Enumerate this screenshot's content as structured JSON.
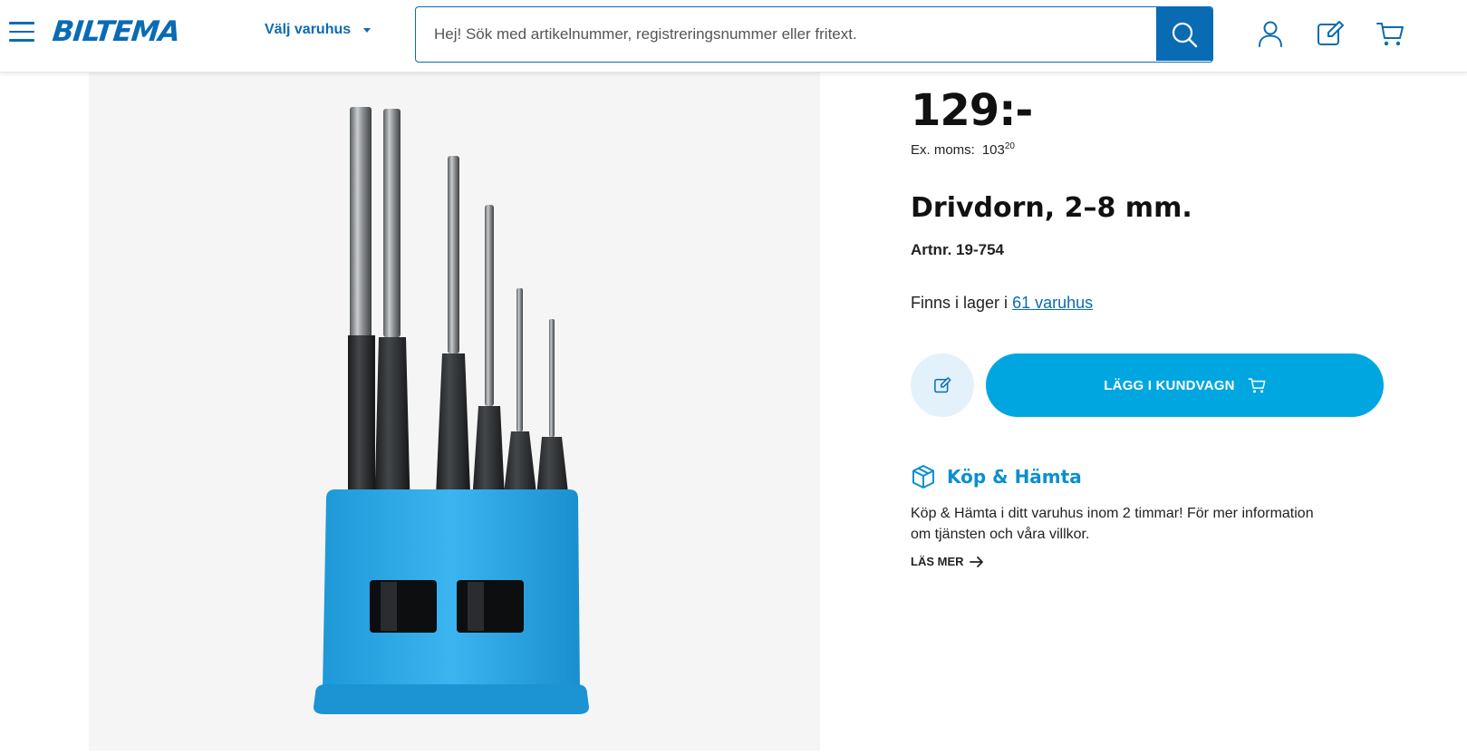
{
  "header": {
    "logo_text": "BILTEMA",
    "store_select_label": "Välj varuhus",
    "search_placeholder": "Hej! Sök med artikelnummer, registreringsnummer eller fritext.",
    "icons": [
      "menu-icon",
      "search-icon",
      "user-icon",
      "edit-icon",
      "cart-icon"
    ]
  },
  "product": {
    "price": "129:-",
    "ex_moms_label": "Ex. moms:",
    "ex_moms_value": "103",
    "ex_moms_decimals": "20",
    "title": "Drivdorn, 2–8 mm.",
    "artnr": "Artnr. 19-754",
    "stock_prefix": "Finns i lager i",
    "stock_link": "61 varuhus",
    "add_to_cart_label": "LÄGG I KUNDVAGN"
  },
  "click_collect": {
    "title": "Köp & Hämta",
    "text": "Köp & Hämta i ditt varuhus inom 2 timmar! För mer information om tjänsten och våra villkor.",
    "read_more": "LÄS MER"
  },
  "colors": {
    "brand_blue": "#0a6bb5",
    "accent_blue": "#00a6e0",
    "holder_blue": "#1ea0e6",
    "image_bg": "#f5f5f5"
  }
}
